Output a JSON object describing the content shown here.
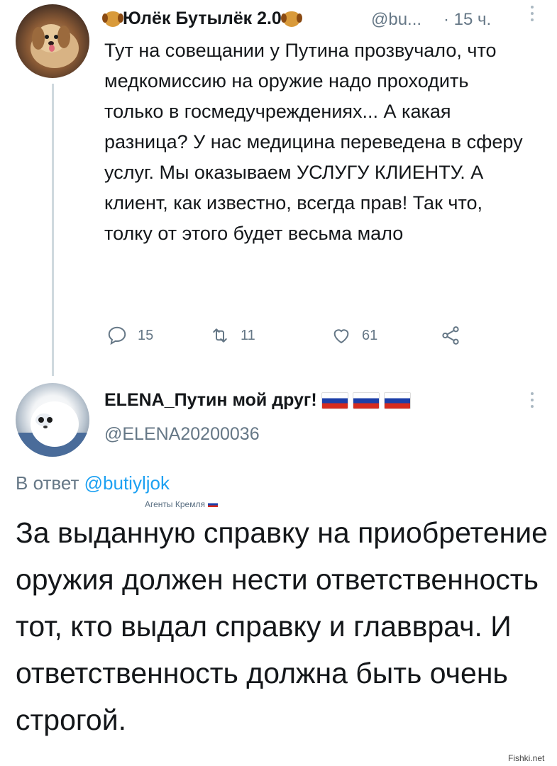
{
  "tweet1": {
    "display_name": "Юлёк Бутылёк 2.0",
    "name_emoji": "dog-face-icon",
    "handle": "@bu...",
    "separator": "·",
    "time": "15 ч.",
    "text": "Тут на совещании у Путина прозвучало, что медкомиссию на оружие надо проходить только в госмедучреждениях... А какая разница? У нас медицина переведена в сферу услуг. Мы оказываем УСЛУГУ КЛИЕНТУ. А клиент, как известно, всегда прав! Так что, толку от этого будет весьма мало",
    "actions": {
      "reply_count": "15",
      "retweet_count": "11",
      "like_count": "61"
    }
  },
  "tweet2": {
    "display_name": "ELENA_Путин мой друг!",
    "flags": [
      "flag-russia-icon",
      "flag-russia-icon",
      "flag-russia-icon"
    ],
    "handle": "@ELENA20200036",
    "reply_prefix": "В ответ",
    "reply_handle": "@butiyljok",
    "overlay_label": "Агенты Кремля",
    "text": "За выданную справку на приобретение оружия должен нести ответственность тот, кто выдал справку и главврач. И ответственность должна быть очень строгой."
  },
  "watermark": "Fishki.net",
  "colors": {
    "text": "#14171a",
    "secondary": "#657786",
    "link": "#1da1f2",
    "thread_line": "#cfd9de"
  }
}
